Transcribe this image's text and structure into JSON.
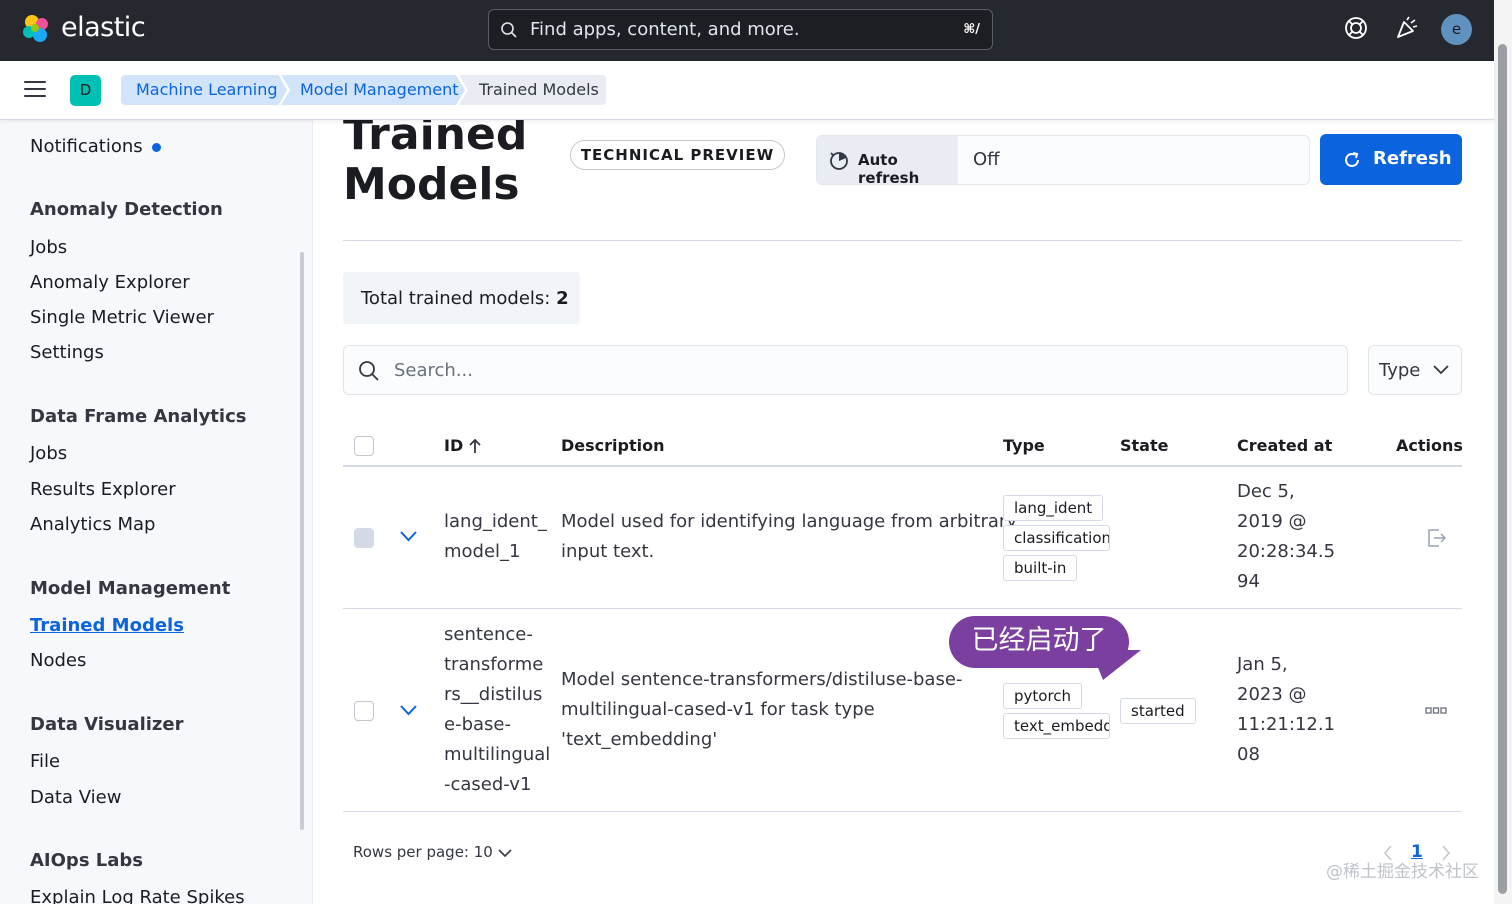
{
  "header": {
    "logo_text": "elastic",
    "search_placeholder": "Find apps, content, and more.",
    "search_shortcut": "⌘/",
    "help_icon": "help-icon",
    "news_icon": "newsfeed-icon",
    "user_initial": "e"
  },
  "nav": {
    "space_initial": "D",
    "breadcrumbs": [
      "Machine Learning",
      "Model Management",
      "Trained Models"
    ]
  },
  "sidebar": {
    "notifications": "Notifications",
    "sections": [
      {
        "title": "Anomaly Detection",
        "items": [
          "Jobs",
          "Anomaly Explorer",
          "Single Metric Viewer",
          "Settings"
        ]
      },
      {
        "title": "Data Frame Analytics",
        "items": [
          "Jobs",
          "Results Explorer",
          "Analytics Map"
        ]
      },
      {
        "title": "Model Management",
        "items": [
          "Trained Models",
          "Nodes"
        ]
      },
      {
        "title": "Data Visualizer",
        "items": [
          "File",
          "Data View"
        ]
      },
      {
        "title": "AIOps Labs",
        "items": [
          "Explain Log Rate Spikes"
        ]
      }
    ],
    "active_item": "Trained Models"
  },
  "page": {
    "title_line1": "Trained",
    "title_line2": "Models",
    "badge": "TECHNICAL PREVIEW",
    "auto_refresh_label": "Auto refresh",
    "auto_refresh_value": "Off",
    "refresh_label": "Refresh",
    "total_label": "Total trained models: ",
    "total_count": "2",
    "search_placeholder": "Search...",
    "type_filter": "Type"
  },
  "table": {
    "columns": [
      "ID",
      "Description",
      "Type",
      "State",
      "Created at",
      "Actions"
    ],
    "rows": [
      {
        "id_lines": [
          "lang_ident_",
          "model_1"
        ],
        "description_lines": [
          "Model used for identifying language from arbitrary",
          "input text."
        ],
        "types": [
          "lang_ident",
          "classification",
          "built-in"
        ],
        "state": "",
        "created_lines": [
          "Dec 5,",
          "2019 @",
          "20:28:34.5",
          "94"
        ]
      },
      {
        "id_lines": [
          "sentence-",
          "transforme",
          "rs__distilus",
          "e-base-",
          "multilingual",
          "-cased-v1"
        ],
        "description_lines": [
          "Model sentence-transformers/distiluse-base-",
          "multilingual-cased-v1 for task type",
          "'text_embedding'"
        ],
        "types": [
          "pytorch",
          "text_embedd"
        ],
        "state": "started",
        "created_lines": [
          "Jan 5,",
          "2023 @",
          "11:21:12.1",
          "08"
        ]
      }
    ]
  },
  "annotation": "已经启动了",
  "footer": {
    "rows_per_page": "Rows per page: 10",
    "current_page": "1"
  },
  "watermark": "@稀土掘金技术社区",
  "colors": {
    "accent": "#0b64dd",
    "header_bg": "#25282f",
    "annotation": "#7b3fa0"
  }
}
